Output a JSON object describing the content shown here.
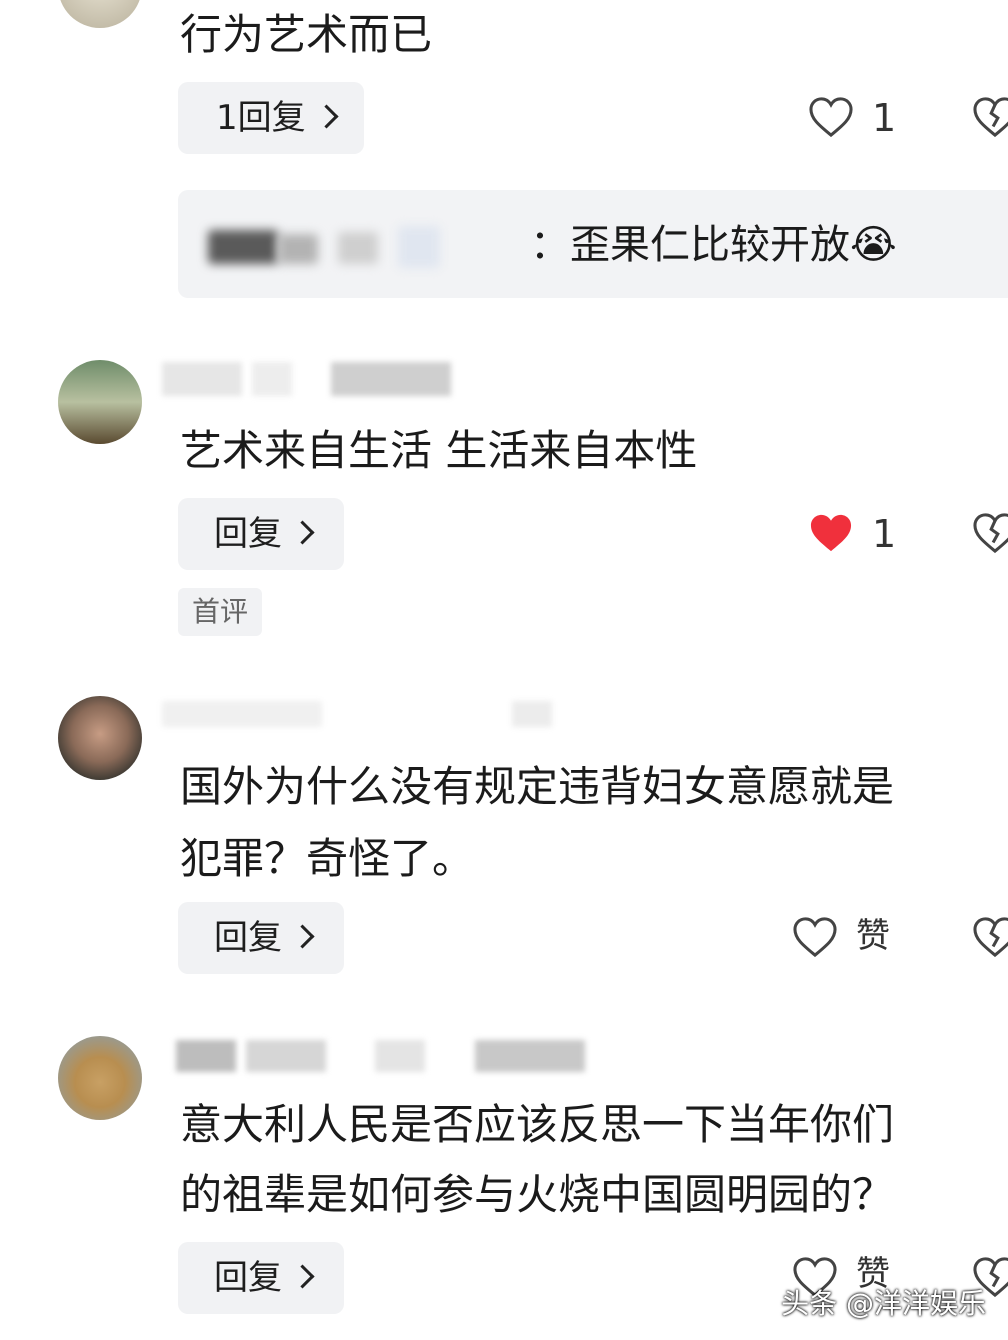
{
  "comments": [
    {
      "text": "行为艺术而已",
      "reply_label": "1回复",
      "likes": "1"
    },
    {
      "text": "艺术来自生活 生活来自本性",
      "reply_label": "回复",
      "likes": "1",
      "tag": "首评"
    },
    {
      "text_line1": "国外为什么没有规定违背妇女意愿就是",
      "text_line2": "犯罪？奇怪了。",
      "reply_label": "回复",
      "likes": "赞"
    },
    {
      "text_line1": "意大利人民是否应该反思一下当年你们",
      "text_line2": "的祖辈是如何参与火烧中国圆明园的？",
      "reply_label": "回复",
      "likes": "赞"
    }
  ],
  "sub_reply": {
    "text": "：歪果仁比较开放",
    "emoji": "😭"
  },
  "watermark": "头条 @洋洋娱乐",
  "colors": {
    "liked_heart": "#f0303c",
    "reply_bg": "#f1f2f4"
  }
}
